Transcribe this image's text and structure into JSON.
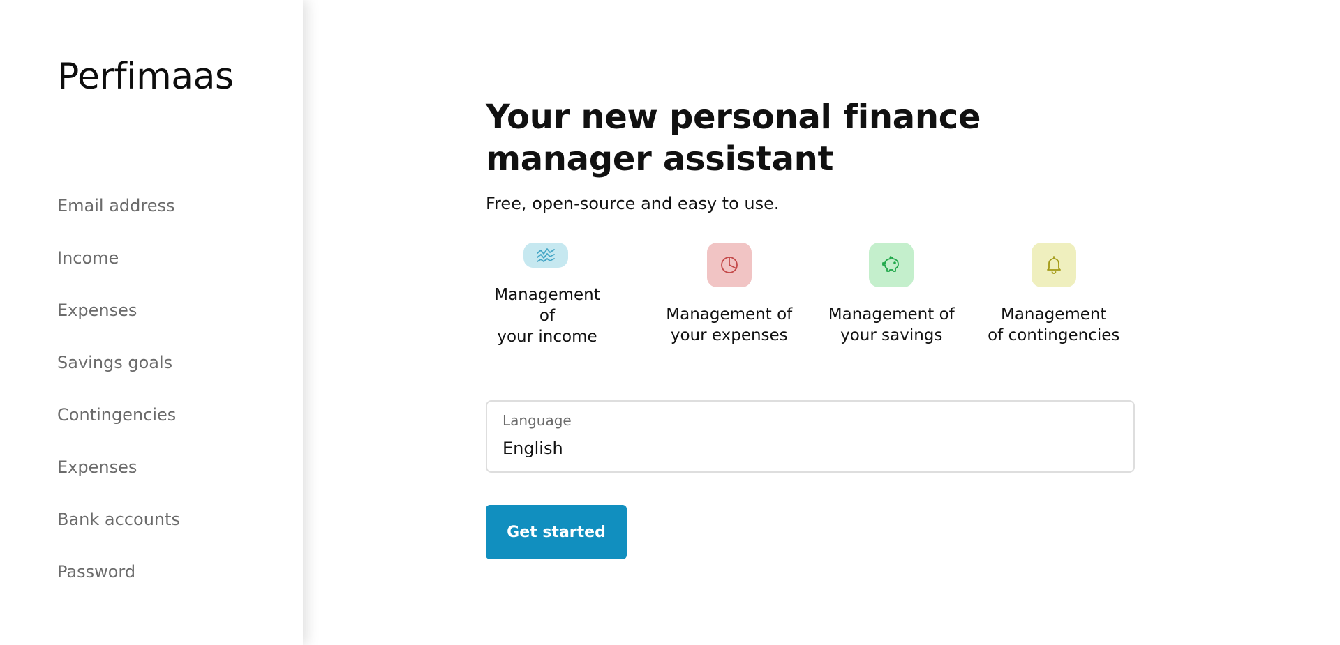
{
  "brand": {
    "name": "Perfimaas"
  },
  "sidebar": {
    "items": [
      {
        "label": "Email address"
      },
      {
        "label": "Income"
      },
      {
        "label": "Expenses"
      },
      {
        "label": "Savings goals"
      },
      {
        "label": "Contingencies"
      },
      {
        "label": "Expenses"
      },
      {
        "label": "Bank accounts"
      },
      {
        "label": "Password"
      }
    ]
  },
  "hero": {
    "title": "Your new personal finance manager assistant",
    "subtitle": "Free, open-source and easy to use."
  },
  "features": [
    {
      "label": "Management of\nyour income",
      "icon": "income-wave-icon",
      "bg": "#c6e8f0",
      "fg": "#46a6c6"
    },
    {
      "label": "Management of\nyour expenses",
      "icon": "pie-chart-icon",
      "bg": "#f1c4c4",
      "fg": "#c44a4a"
    },
    {
      "label": "Management of\nyour savings",
      "icon": "piggy-bank-icon",
      "bg": "#c4efcc",
      "fg": "#20a84a"
    },
    {
      "label": "Management\nof contingencies",
      "icon": "bell-icon",
      "bg": "#efefbe",
      "fg": "#a39a16"
    }
  ],
  "language": {
    "label": "Language",
    "value": "English"
  },
  "cta": {
    "label": "Get started",
    "color": "#118fbf"
  }
}
